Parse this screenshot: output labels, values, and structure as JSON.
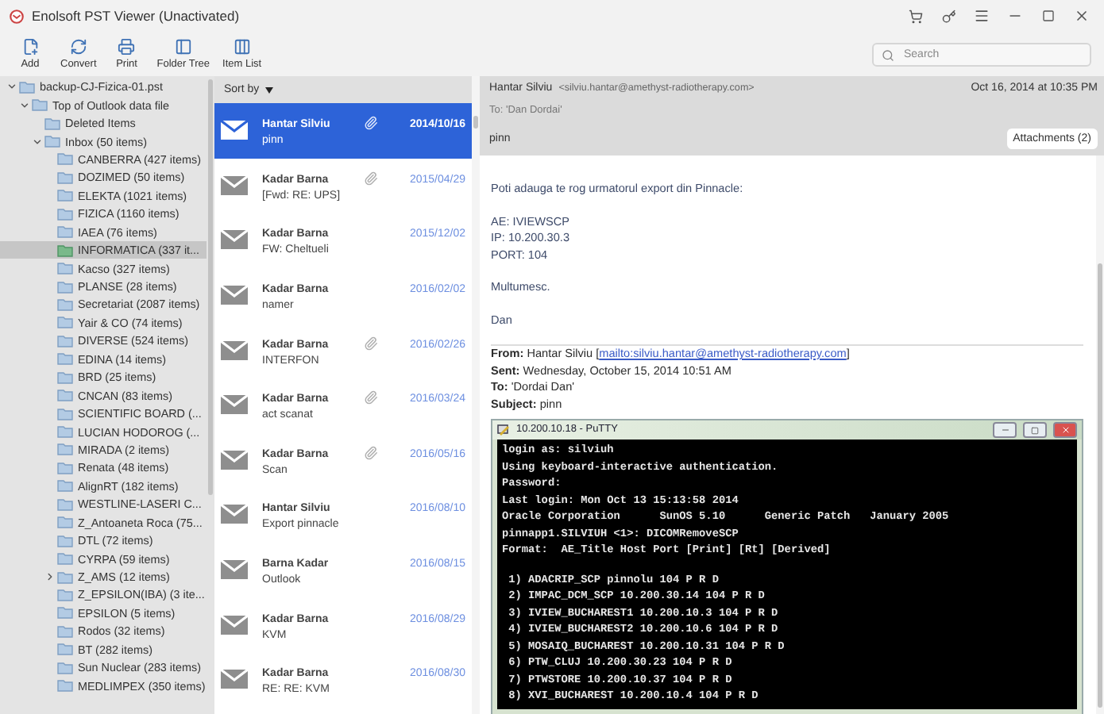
{
  "window": {
    "title": "Enolsoft PST Viewer (Unactivated)"
  },
  "toolbar": [
    {
      "kind": "add",
      "label": "Add"
    },
    {
      "kind": "convert",
      "label": "Convert"
    },
    {
      "kind": "print",
      "label": "Print"
    },
    {
      "kind": "folder_tree",
      "label": "Folder Tree"
    },
    {
      "kind": "item_list",
      "label": "Item List"
    }
  ],
  "search": {
    "placeholder": "Search"
  },
  "folder_tree": [
    {
      "label": "backup-CJ-Fizica-01.pst",
      "expanded": true,
      "selected": false,
      "children": [
        {
          "label": "Top of Outlook data file",
          "expanded": true,
          "selected": false,
          "children": [
            {
              "label": "Deleted Items",
              "selected": false
            },
            {
              "label": "Inbox (50 items)",
              "expanded": true,
              "selected": false,
              "children": [
                {
                  "label": "CANBERRA (427 items)",
                  "selected": false
                },
                {
                  "label": "DOZIMED (50 items)",
                  "selected": false
                },
                {
                  "label": "ELEKTA (1021 items)",
                  "selected": false
                },
                {
                  "label": "FIZICA (1160 items)",
                  "selected": false
                },
                {
                  "label": "IAEA (76 items)",
                  "selected": false
                },
                {
                  "label": "INFORMATICA (337 it...",
                  "selected": true
                },
                {
                  "label": "Kacso (327 items)",
                  "selected": false
                },
                {
                  "label": "PLANSE (28 items)",
                  "selected": false
                },
                {
                  "label": "Secretariat (2087 items)",
                  "selected": false
                },
                {
                  "label": "Yair & CO (74 items)",
                  "selected": false
                },
                {
                  "label": "DIVERSE (524 items)",
                  "selected": false
                },
                {
                  "label": "EDINA (14 items)",
                  "selected": false
                },
                {
                  "label": "BRD (25 items)",
                  "selected": false
                },
                {
                  "label": "CNCAN (83 items)",
                  "selected": false
                },
                {
                  "label": "SCIENTIFIC BOARD (...",
                  "selected": false
                },
                {
                  "label": "LUCIAN HODOROG (...",
                  "selected": false
                },
                {
                  "label": "MIRADA (2 items)",
                  "selected": false
                },
                {
                  "label": "Renata (48 items)",
                  "selected": false
                },
                {
                  "label": "AlignRT (182 items)",
                  "selected": false
                },
                {
                  "label": "WESTLINE-LASERI C...",
                  "selected": false
                },
                {
                  "label": "Z_Antoaneta Roca (75...",
                  "selected": false
                },
                {
                  "label": "DTL (72 items)",
                  "selected": false
                },
                {
                  "label": "CYRPA (59 items)",
                  "selected": false
                },
                {
                  "label": "Z_AMS (12 items)",
                  "expanded": false,
                  "selected": false
                },
                {
                  "label": "Z_EPSILON(IBA) (3 ite...",
                  "selected": false
                },
                {
                  "label": "EPSILON (5 items)",
                  "selected": false
                },
                {
                  "label": "Rodos (32 items)",
                  "selected": false
                },
                {
                  "label": "BT (282 items)",
                  "selected": false
                },
                {
                  "label": "Sun Nuclear (283 items)",
                  "selected": false
                },
                {
                  "label": "MEDLIMPEX (350 items)",
                  "selected": false
                }
              ]
            }
          ]
        }
      ]
    }
  ],
  "message_list": {
    "sort_label": "Sort by",
    "messages": [
      {
        "sender": "Hantar Silviu",
        "subject": "pinn",
        "date": "2014/10/16",
        "attachment": true,
        "selected": true
      },
      {
        "sender": "Kadar Barna",
        "subject": "[Fwd: RE: UPS]",
        "date": "2015/04/29",
        "attachment": true,
        "selected": false
      },
      {
        "sender": "Kadar Barna",
        "subject": "FW: Cheltueli",
        "date": "2015/12/02",
        "attachment": false,
        "selected": false
      },
      {
        "sender": "Kadar Barna",
        "subject": "namer",
        "date": "2016/02/02",
        "attachment": false,
        "selected": false
      },
      {
        "sender": "Kadar Barna",
        "subject": "INTERFON",
        "date": "2016/02/26",
        "attachment": true,
        "selected": false
      },
      {
        "sender": "Kadar Barna",
        "subject": "act scanat",
        "date": "2016/03/24",
        "attachment": true,
        "selected": false
      },
      {
        "sender": "Kadar Barna",
        "subject": "Scan",
        "date": "2016/05/16",
        "attachment": true,
        "selected": false
      },
      {
        "sender": "Hantar Silviu",
        "subject": "Export pinnacle",
        "date": "2016/08/10",
        "attachment": false,
        "selected": false
      },
      {
        "sender": "Barna Kadar",
        "subject": "Outlook",
        "date": "2016/08/15",
        "attachment": false,
        "selected": false
      },
      {
        "sender": "Kadar Barna",
        "subject": "KVM",
        "date": "2016/08/29",
        "attachment": false,
        "selected": false
      },
      {
        "sender": "Kadar Barna",
        "subject": "RE: RE: KVM",
        "date": "2016/08/30",
        "attachment": false,
        "selected": false
      }
    ]
  },
  "reading_pane": {
    "sender": "Hantar Silviu",
    "address": "<silviu.hantar@amethyst-radiotherapy.com>",
    "date": "Oct 16, 2014 at 10:35 PM",
    "to": "To: 'Dan Dordai'",
    "subject": "pinn",
    "attachments_button": "Attachments (2)",
    "body": [
      [
        "Poti adauga te rog urmatorul export din Pinnacle:"
      ],
      [
        "AE: IVIEWSCP",
        "IP: 10.200.30.3",
        "PORT: 104"
      ],
      [
        "Multumesc."
      ],
      [
        "Dan"
      ]
    ],
    "quoted_header": [
      {
        "label": "From:",
        "text": "Hantar Silviu [",
        "link": "mailto:silviu.hantar@amethyst-radiotherapy.com",
        "after": "]"
      },
      {
        "label": "Sent:",
        "text": "Wednesday, October 15, 2014 10:51 AM"
      },
      {
        "label": "To:",
        "text": "'Dordai Dan'"
      },
      {
        "label": "Subject:",
        "text": "pinn"
      }
    ],
    "screenshot": {
      "title": "10.200.10.18 - PuTTY",
      "session_lines": [
        "login as: silviuh",
        "Using keyboard-interactive authentication.",
        "Password:",
        "Last login: Mon Oct 13 15:13:58 2014",
        "Oracle Corporation      SunOS 5.10      Generic Patch   January 2005",
        "pinnapp1.SILVIUH <1>: DICOMRemoveSCP",
        "Format:  AE_Title Host Port [Print] [Rt] [Derived]"
      ],
      "list_lines": [
        " 1) ADACRIP_SCP pinnolu 104 P R D",
        " 2) IMPAC_DCM_SCP 10.200.30.14 104 P R D",
        " 3) IVIEW_BUCHAREST1 10.200.10.3 104 P R D",
        " 4) IVIEW_BUCHAREST2 10.200.10.6 104 P R D",
        " 5) MOSAIQ_BUCHAREST 10.200.10.31 104 P R D",
        " 6) PTW_CLUJ 10.200.30.23 104 P R D",
        " 7) PTWSTORE 10.200.10.37 104 P R D",
        " 8) XVI_BUCHAREST 10.200.10.4 104 P R D"
      ]
    }
  }
}
